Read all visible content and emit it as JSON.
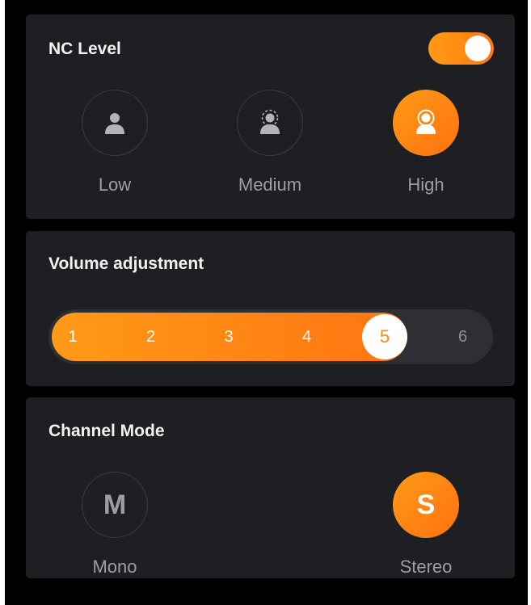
{
  "colors": {
    "accent": "#ff8a14",
    "card_background": "#1e1f23",
    "text_primary": "#f2f2f2",
    "text_secondary": "#9d9ea3"
  },
  "nc_level": {
    "title": "NC Level",
    "toggle_on": true,
    "options": [
      {
        "label": "Low",
        "icon": "person-low-icon",
        "selected": false
      },
      {
        "label": "Medium",
        "icon": "person-medium-icon",
        "selected": false
      },
      {
        "label": "High",
        "icon": "person-high-icon",
        "selected": true
      }
    ]
  },
  "volume": {
    "title": "Volume adjustment",
    "steps": [
      "1",
      "2",
      "3",
      "4",
      "5",
      "6"
    ],
    "current": "5"
  },
  "channel_mode": {
    "title": "Channel Mode",
    "options": [
      {
        "letter": "M",
        "label": "Mono",
        "selected": false
      },
      {
        "letter": "S",
        "label": "Stereo",
        "selected": true
      }
    ]
  }
}
